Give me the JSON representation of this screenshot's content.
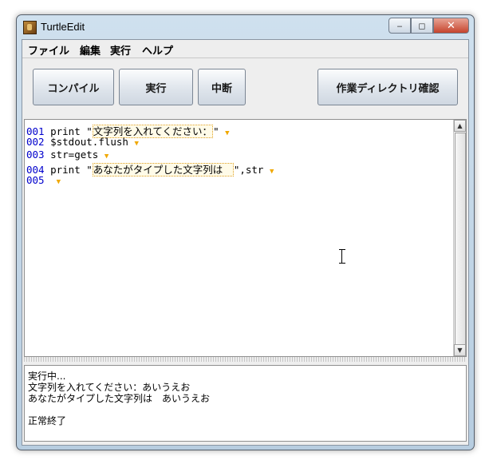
{
  "window": {
    "title": "TurtleEdit",
    "minimize": "‒",
    "maximize": "◻",
    "close": "✕"
  },
  "menu": [
    "ファイル",
    "編集",
    "実行",
    "ヘルプ"
  ],
  "toolbar": {
    "compile": "コンパイル",
    "run": "実行",
    "stop": "中断",
    "check_dir": "作業ディレクトリ確認"
  },
  "editor": {
    "lines": [
      {
        "num": "001",
        "pre": "print \"",
        "hl": "文字列を入れてください：",
        "post": "\""
      },
      {
        "num": "002",
        "pre": "$stdout.flush",
        "hl": "",
        "post": ""
      },
      {
        "num": "003",
        "pre": "str=gets",
        "hl": "",
        "post": ""
      },
      {
        "num": "004",
        "pre": "print \"",
        "hl": "あなたがタイプした文字列は　",
        "post": "\",str"
      },
      {
        "num": "005",
        "pre": "",
        "hl": "",
        "post": ""
      }
    ],
    "eol_marker": "▼",
    "scroll_up": "▲",
    "scroll_down": "▼"
  },
  "output": {
    "lines": [
      "実行中...",
      "文字列を入れてください：あいうえお",
      "あなたがタイプした文字列は　あいうえお",
      "",
      "正常終了"
    ]
  }
}
